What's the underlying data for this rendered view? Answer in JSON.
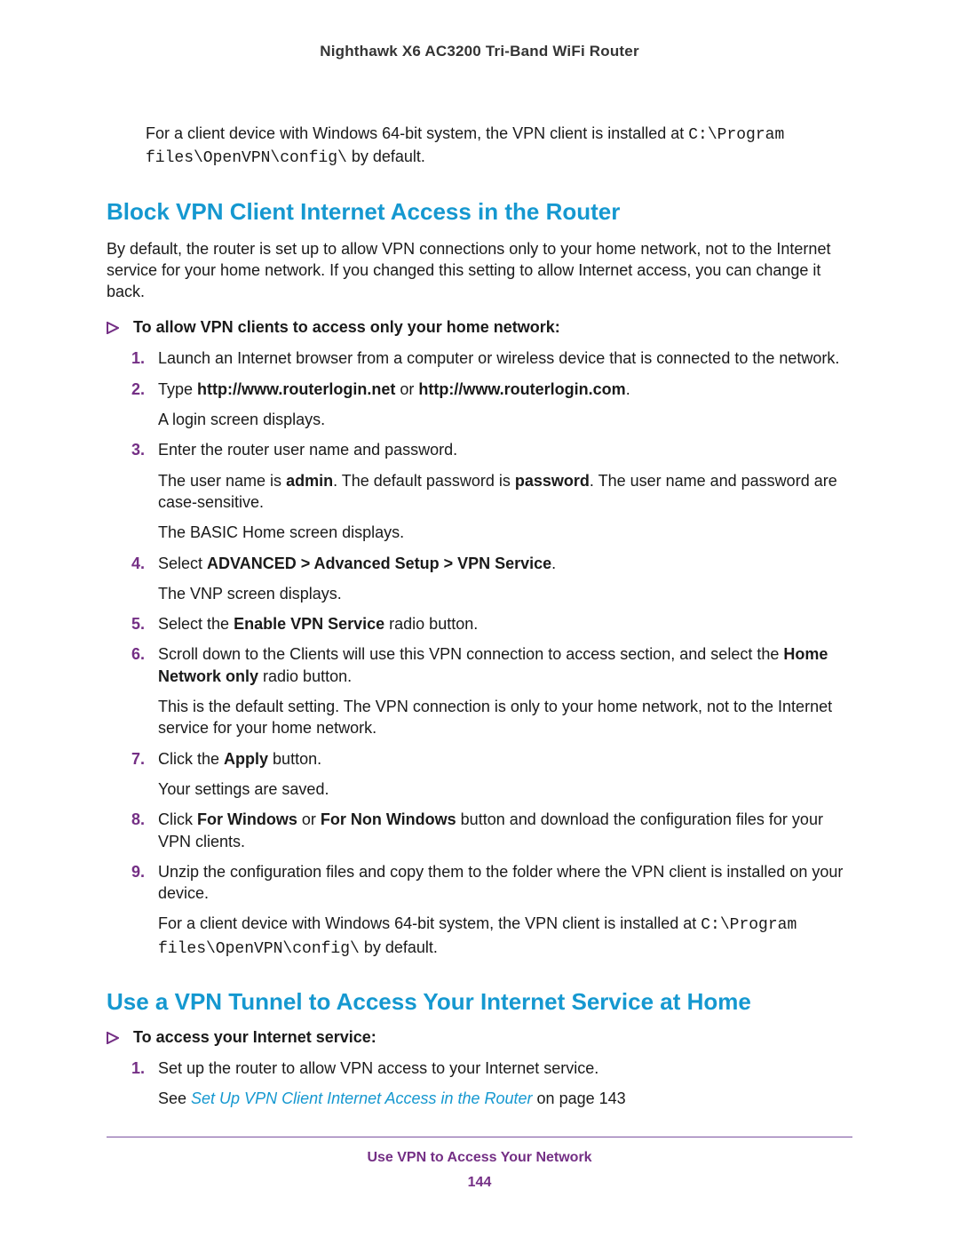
{
  "header": {
    "title": "Nighthawk X6 AC3200 Tri-Band WiFi Router"
  },
  "intro": {
    "pre": "For a client device with Windows 64-bit system, the VPN client is installed at ",
    "code": "C:\\Program files\\OpenVPN\\config\\",
    "post": " by default."
  },
  "section1": {
    "heading": "Block VPN Client Internet Access in the Router",
    "desc": "By default, the router is set up to allow VPN connections only to your home network, not to the Internet service for your home network. If you changed this setting to allow Internet access, you can change it back.",
    "proc_heading": "To allow VPN clients to access only your home network:",
    "steps": {
      "s1": "Launch an Internet browser from a computer or wireless device that is connected to the network.",
      "s2_pre": "Type ",
      "s2_b1": "http://www.routerlogin.net",
      "s2_mid": " or ",
      "s2_b2": "http://www.routerlogin.com",
      "s2_post": ".",
      "s2_note": "A login screen displays.",
      "s3": "Enter the router user name and password.",
      "s3_note1a": "The user name is ",
      "s3_note1b": "admin",
      "s3_note1c": ". The default password is ",
      "s3_note1d": "password",
      "s3_note1e": ". The user name and password are case-sensitive.",
      "s3_note2": "The BASIC Home screen displays.",
      "s4_pre": "Select ",
      "s4_b": "ADVANCED > Advanced Setup > VPN Service",
      "s4_post": ".",
      "s4_note": "The VNP screen displays.",
      "s5_pre": "Select the ",
      "s5_b": "Enable VPN Service",
      "s5_post": " radio button.",
      "s6_pre": "Scroll down to the Clients will use this VPN connection to access section, and select the ",
      "s6_b": "Home Network only",
      "s6_post": " radio button.",
      "s6_note": "This is the default setting. The VPN connection is only to your home network, not to the Internet service for your home network.",
      "s7_pre": "Click the ",
      "s7_b": "Apply",
      "s7_post": " button.",
      "s7_note": "Your settings are saved.",
      "s8_pre": "Click ",
      "s8_b1": "For Windows",
      "s8_mid": " or ",
      "s8_b2": "For Non Windows",
      "s8_post": " button and download the configuration files for your VPN clients.",
      "s9": "Unzip the configuration files and copy them to the folder where the VPN client is installed on your device.",
      "s9_note_pre": "For a client device with Windows 64-bit system, the VPN client is installed at ",
      "s9_note_code": "C:\\Program files\\OpenVPN\\config\\",
      "s9_note_post": " by default."
    }
  },
  "section2": {
    "heading": "Use a VPN Tunnel to Access Your Internet Service at Home",
    "proc_heading": "To access your Internet service:",
    "steps": {
      "s1": "Set up the router to allow VPN access to your Internet service.",
      "s1_see": "See ",
      "s1_xref": "Set Up VPN Client Internet Access in the Router",
      "s1_see_post": " on page 143"
    }
  },
  "footer": {
    "chapter": "Use VPN to Access Your Network",
    "page": "144"
  }
}
